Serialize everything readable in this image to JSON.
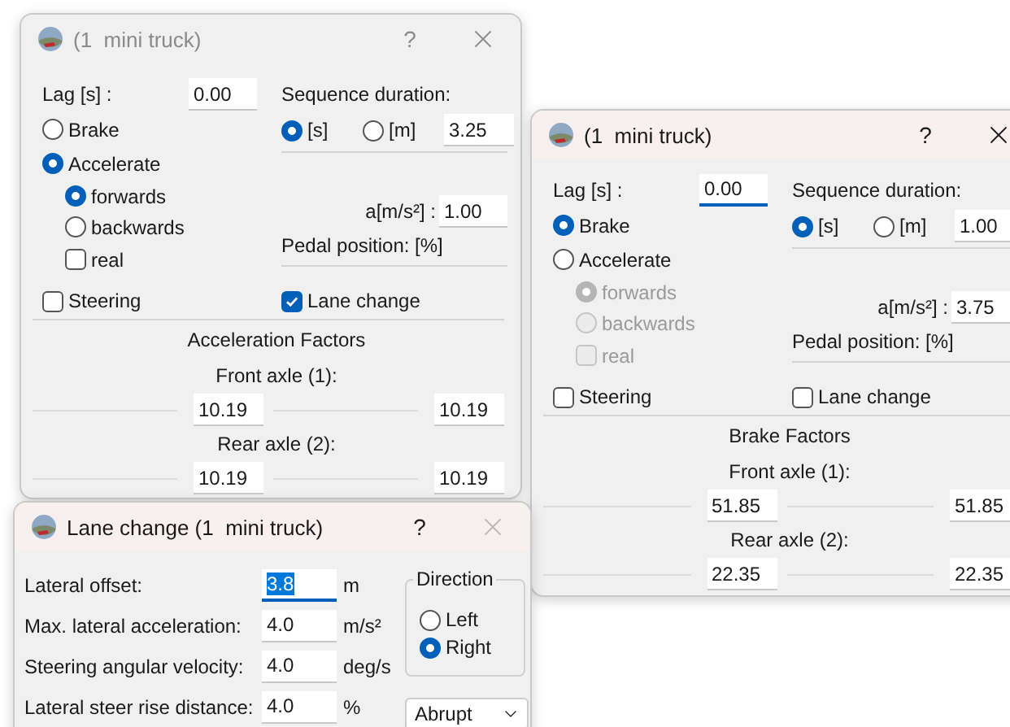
{
  "windows": [
    {
      "kind": "truck",
      "title": "(1  mini truck)",
      "help": "?",
      "active": false,
      "lag": {
        "label": "Lag [s] :",
        "value": "0.00",
        "focused": false
      },
      "modes": [
        {
          "label": "Brake",
          "selected": false
        },
        {
          "label": "Accelerate",
          "selected": true
        }
      ],
      "directions": [
        {
          "label": "forwards",
          "selected": true,
          "disabled": false
        },
        {
          "label": "backwards",
          "selected": false,
          "disabled": false
        }
      ],
      "real": {
        "label": "real",
        "checked": false,
        "disabled": false
      },
      "sequence": {
        "label": "Sequence duration:",
        "units": [
          {
            "label": "[s]",
            "selected": true
          },
          {
            "label": "[m]",
            "selected": false
          }
        ],
        "value": "3.25"
      },
      "accel": {
        "label": "a[m/s²] :",
        "value": "1.00"
      },
      "pedal": "Pedal position: [%]",
      "steering": {
        "label": "Steering",
        "checked": false
      },
      "lane_change": {
        "label": "Lane change",
        "checked": true
      },
      "factors": {
        "title": "Acceleration Factors",
        "axles": [
          {
            "label": "Front axle (1):",
            "values": [
              "10.19",
              "10.19"
            ]
          },
          {
            "label": "Rear axle (2):",
            "values": [
              "10.19",
              "10.19"
            ]
          }
        ]
      }
    },
    {
      "kind": "truck",
      "title": "(1  mini truck)",
      "help": "?",
      "active": true,
      "lag": {
        "label": "Lag [s] :",
        "value": "0.00",
        "focused": true
      },
      "modes": [
        {
          "label": "Brake",
          "selected": true
        },
        {
          "label": "Accelerate",
          "selected": false
        }
      ],
      "directions": [
        {
          "label": "forwards",
          "selected": true,
          "disabled": true
        },
        {
          "label": "backwards",
          "selected": false,
          "disabled": true
        }
      ],
      "real": {
        "label": "real",
        "checked": false,
        "disabled": true
      },
      "sequence": {
        "label": "Sequence duration:",
        "units": [
          {
            "label": "[s]",
            "selected": true
          },
          {
            "label": "[m]",
            "selected": false
          }
        ],
        "value": "1.00"
      },
      "accel": {
        "label": "a[m/s²] :",
        "value": "3.75"
      },
      "pedal": "Pedal position: [%]",
      "steering": {
        "label": "Steering",
        "checked": false
      },
      "lane_change": {
        "label": "Lane change",
        "checked": false
      },
      "factors": {
        "title": "Brake Factors",
        "axles": [
          {
            "label": "Front axle (1):",
            "values": [
              "51.85",
              "51.85"
            ]
          },
          {
            "label": "Rear axle (2):",
            "values": [
              "22.35",
              "22.35"
            ]
          }
        ]
      }
    },
    {
      "kind": "lane",
      "title": "Lane change (1  mini truck)",
      "help": "?",
      "active": true,
      "close_disabled": true,
      "rows": [
        {
          "label": "Lateral offset:",
          "value": "3.8",
          "unit": "m",
          "selected": true
        },
        {
          "label": "Max. lateral acceleration:",
          "value": "4.0",
          "unit": "m/s²",
          "selected": false
        },
        {
          "label": "Steering angular velocity:",
          "value": "4.0",
          "unit": "deg/s",
          "selected": false
        },
        {
          "label": "Lateral steer rise distance:",
          "value": "4.0",
          "unit": "%",
          "selected": false
        }
      ],
      "direction": {
        "title": "Direction",
        "options": [
          {
            "label": "Left",
            "selected": false
          },
          {
            "label": "Right",
            "selected": true
          }
        ]
      },
      "profile": "Abrupt"
    }
  ]
}
